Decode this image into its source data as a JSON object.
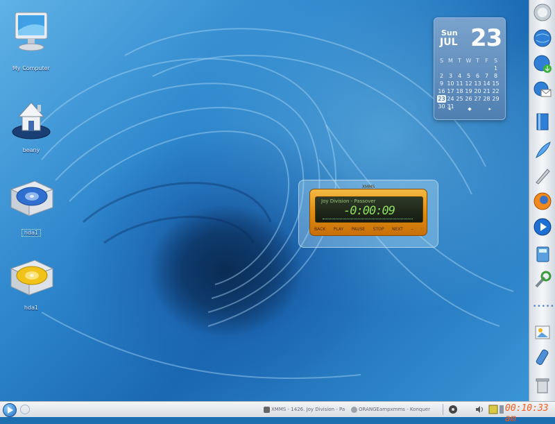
{
  "desktop": {
    "icons": [
      {
        "name": "my-computer-icon",
        "label": "My Computer"
      },
      {
        "name": "home-folder-icon",
        "label": "beany"
      },
      {
        "name": "hard-drive-icon",
        "label": "hda1"
      },
      {
        "name": "hard-drive-icon",
        "label": "hda1"
      }
    ]
  },
  "calendar": {
    "day_of_week": "Sun",
    "month": "JUL",
    "day": "23",
    "weekday_headers": [
      "S",
      "M",
      "T",
      "W",
      "T",
      "F",
      "S"
    ],
    "weeks": [
      [
        "",
        "",
        "",
        "",
        "",
        "",
        "1"
      ],
      [
        "2",
        "3",
        "4",
        "5",
        "6",
        "7",
        "8"
      ],
      [
        "9",
        "10",
        "11",
        "12",
        "13",
        "14",
        "15"
      ],
      [
        "16",
        "17",
        "18",
        "19",
        "20",
        "21",
        "22"
      ],
      [
        "23",
        "24",
        "25",
        "26",
        "27",
        "28",
        "29"
      ],
      [
        "30",
        "31",
        "",
        "",
        "",
        "",
        ""
      ]
    ],
    "today": "23",
    "nav": {
      "prev": "◂",
      "home": "◆",
      "next": "▸"
    }
  },
  "xmms": {
    "title": "XMMS",
    "song": "Joy Division - Passover",
    "time": "-0:00:09",
    "controls": [
      "BACK",
      "PLAY",
      "PAUSE",
      "STOP",
      "NEXT",
      "–",
      "·"
    ]
  },
  "right_panel": {
    "icons": [
      "quit-icon",
      "globe-icon",
      "globe-download-icon",
      "mail-icon",
      "book-icon",
      "feather-pen-icon",
      "pencil-icon",
      "firefox-icon",
      "media-player-icon",
      "calculator-icon",
      "tools-icon",
      "more-dots-icon",
      "image-viewer-icon",
      "remote-control-icon",
      "trash-icon"
    ]
  },
  "taskbar": {
    "tasks": [
      {
        "label": "XMMS - 1426. Joy Division - Pa",
        "icon": "xmms-icon"
      },
      {
        "label": "ORANGEampxmms - Konquer",
        "icon": "konqueror-icon"
      }
    ],
    "tray_icons": [
      "network-icon",
      "volume-icon",
      "notes-icon",
      "display-icon"
    ],
    "clock": "00:10:33 am"
  },
  "colors": {
    "accent": "#1c6cc0",
    "clock": "#ff5a1a",
    "xmms_orange": "#e08d12",
    "lcd_green": "#8fe05e"
  }
}
